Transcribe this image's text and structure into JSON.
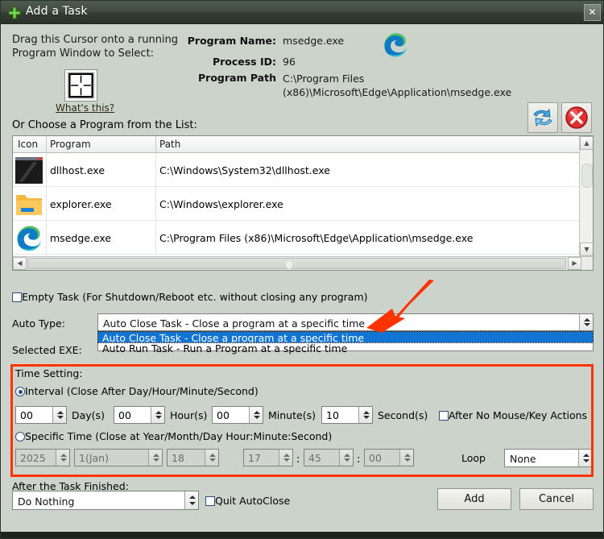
{
  "window": {
    "title": "Add a Task",
    "title_icon": "green-plus-icon",
    "close_label": "✕"
  },
  "top": {
    "drag_instruction": "Drag this Cursor onto a running Program Window to Select:",
    "whats_this": "What's this?",
    "cursor_icon": "crosshair-cursor-icon",
    "program_name_label": "Program Name:",
    "program_name_value": "msedge.exe",
    "process_id_label": "Process ID:",
    "process_id_value": "96",
    "program_path_label": "Program Path",
    "program_path_value": "C:\\Program Files (x86)\\Microsoft\\Edge\\Application\\msedge.exe",
    "app_icon": "edge-logo-icon",
    "refresh_icon": "refresh-icon",
    "stop_icon": "delete-red-x-icon",
    "list_label": "Or Choose a Program from the List:"
  },
  "table": {
    "columns": [
      "Icon",
      "Program",
      "Path"
    ],
    "rows": [
      {
        "icon": "dllhost-icon",
        "program": "dllhost.exe",
        "path": "C:\\Windows\\System32\\dllhost.exe"
      },
      {
        "icon": "explorer-folder-icon",
        "program": "explorer.exe",
        "path": "C:\\Windows\\explorer.exe"
      },
      {
        "icon": "edge-logo-icon",
        "program": "msedge.exe",
        "path": "C:\\Program Files (x86)\\Microsoft\\Edge\\Application\\msedge.exe"
      },
      {
        "icon": "dllhost-icon",
        "program": "",
        "path": ""
      }
    ]
  },
  "options": {
    "empty_task_label": "Empty Task (For Shutdown/Reboot etc. without closing any program)",
    "empty_task_checked": false,
    "auto_type_label": "Auto Type:",
    "auto_type_value": "Auto Close Task - Close a program at a specific time",
    "auto_type_options": [
      "Auto Close Task - Close a program at a specific time",
      "Auto Run Task - Run a Program at a specific time"
    ],
    "auto_type_selected_index": 0,
    "auto_type_open": true,
    "selected_exe_label": "Selected EXE:"
  },
  "time_setting": {
    "group_label": "Time Setting:",
    "interval_label": "Interval (Close After Day/Hour/Minute/Second)",
    "interval_selected": true,
    "days_value": "00",
    "days_unit": "Day(s)",
    "hours_value": "00",
    "hours_unit": "Hour(s)",
    "minutes_value": "00",
    "minutes_unit": "Minute(s)",
    "seconds_value": "10",
    "seconds_unit": "Second(s)",
    "after_no_action_label": "After No Mouse/Key Actions",
    "after_no_action_checked": false,
    "specific_label": "Specific Time (Close at Year/Month/Day Hour:Minute:Second)",
    "specific_selected": false,
    "year_value": "2025",
    "month_value": "1(Jan)",
    "day_value": "18",
    "hour_value": "17",
    "minute_value": "45",
    "second_value": "00",
    "time_sep": ":",
    "loop_label": "Loop",
    "loop_value": "None"
  },
  "bottom": {
    "after_task_label": "After the Task Finished:",
    "after_task_value": "Do Nothing",
    "quit_autoclose_label": "Quit AutoClose",
    "quit_autoclose_checked": false,
    "add_label": "Add",
    "cancel_label": "Cancel"
  },
  "annotation": {
    "arrow_color": "#ff3300",
    "box_color": "#ff3300"
  }
}
